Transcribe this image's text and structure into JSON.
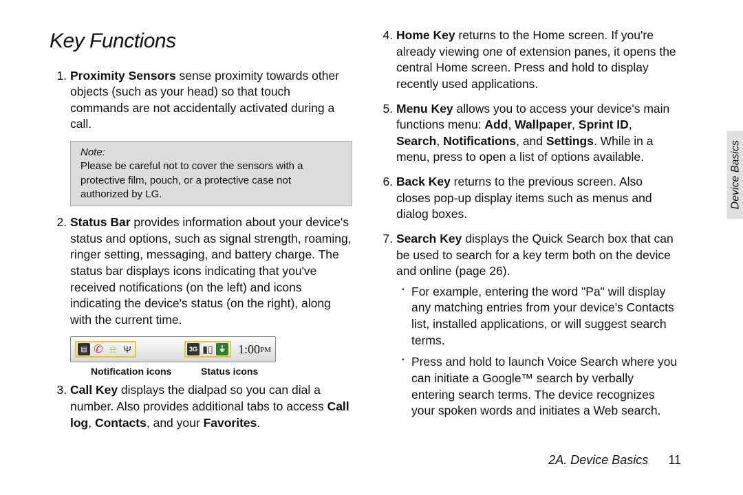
{
  "title": "Key Functions",
  "side_tab": "Device Basics",
  "footer": {
    "section": "2A. Device Basics",
    "page": "11"
  },
  "note": {
    "label": "Note:",
    "body": "Please be careful not to cover the sensors with a protective film, pouch, or a protective case not authorized by LG."
  },
  "status_bar": {
    "time": "1:00",
    "ampm": "PM",
    "label_left": "Notification icons",
    "label_right": "Status icons",
    "threeg": "3G",
    "batt": "⏚"
  },
  "left": {
    "item1": {
      "bold": "Proximity Sensors",
      "rest": " sense proximity towards other objects (such as your head) so that touch commands are not accidentally activated during a call."
    },
    "item2": {
      "bold": "Status Bar",
      "rest": " provides information about your device's status and options, such as signal strength, roaming, ringer setting, messaging, and battery charge. The status bar displays icons indicating that you've received notifications (on the left) and icons indicating the device's status (on the right), along with the current time."
    },
    "item3": {
      "bold": "Call Key",
      "text_a": " displays the dialpad so you can dial a number. Also provides additional tabs to access ",
      "bold_b": "Call log",
      "comma": ", ",
      "bold_c": "Contacts",
      "text_c": ", and your ",
      "bold_d": "Favorites",
      "period": "."
    }
  },
  "right": {
    "item4": {
      "bold": "Home Key",
      "rest": " returns to the Home screen. If you're already viewing one of extension panes, it opens the central Home screen. Press and hold to display recently used applications."
    },
    "item5": {
      "bold": "Menu Key",
      "text_a": " allows you to access your device's main functions menu: ",
      "b1": "Add",
      "c1": ", ",
      "b2": "Wallpaper",
      "c2": ", ",
      "b3": "Sprint ID",
      "c3": ", ",
      "b4": "Search",
      "c4": ", ",
      "b5": "Notifications",
      "c5": ", and ",
      "b6": "Settings",
      "text_b": ". While in a menu, press to open a list of options available."
    },
    "item6": {
      "bold": "Back Key",
      "rest": " returns to the previous screen. Also closes pop-up display items such as menus and dialog boxes."
    },
    "item7": {
      "bold": "Search Key",
      "rest": " displays the Quick Search box that can be used to search for a key term both on the device and online (page 26).",
      "sub1": "For example, entering the word \"Pa\" will display any matching entries from your device's Contacts list, installed applications, or will suggest search terms.",
      "sub2": "Press and hold to launch Voice Search where you can initiate a Google™ search by verbally entering search terms. The device recognizes your spoken words and initiates a Web search."
    }
  }
}
